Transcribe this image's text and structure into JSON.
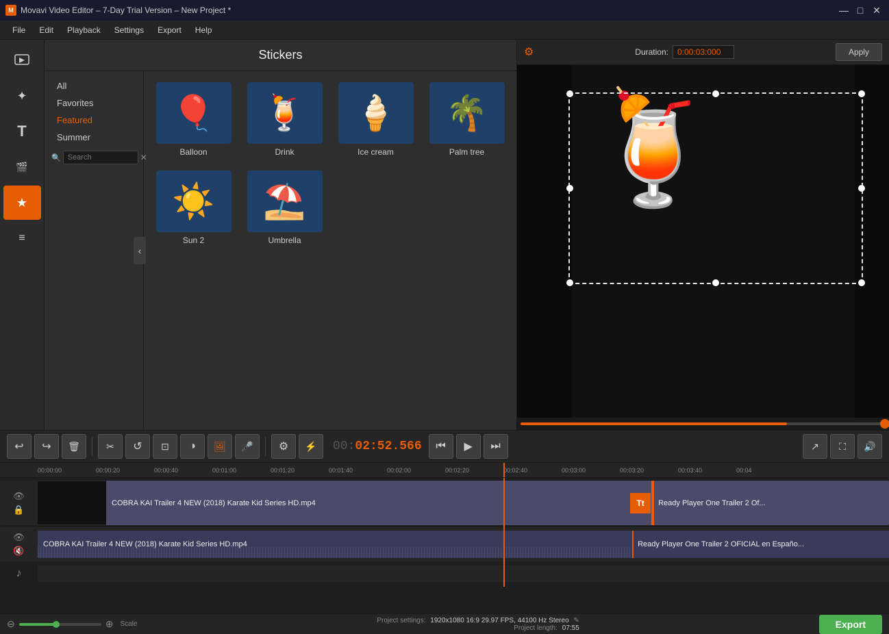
{
  "titlebar": {
    "icon": "M",
    "title": "Movavi Video Editor – 7-Day Trial Version – New Project *",
    "minimize": "—",
    "maximize": "□",
    "close": "✕"
  },
  "menubar": {
    "items": [
      "File",
      "Edit",
      "Playback",
      "Settings",
      "Export",
      "Help"
    ]
  },
  "stickers": {
    "panel_title": "Stickers",
    "categories": [
      "All",
      "Favorites",
      "Featured",
      "Summer"
    ],
    "active_category": "Featured",
    "items": [
      {
        "label": "Balloon",
        "emoji": "🎈"
      },
      {
        "label": "Drink",
        "emoji": "🍹"
      },
      {
        "label": "Ice cream",
        "emoji": "🍦"
      },
      {
        "label": "Palm tree",
        "emoji": "🌴"
      },
      {
        "label": "Sun 2",
        "emoji": "☀️"
      },
      {
        "label": "Umbrella",
        "emoji": "⛱️"
      }
    ],
    "search_placeholder": "Search"
  },
  "preview": {
    "gear_label": "⚙",
    "duration_label": "Duration:",
    "duration_value": "0:00:03:000",
    "apply_label": "Apply"
  },
  "timeline_controls": {
    "undo": "↩",
    "redo": "↪",
    "delete": "🗑",
    "cut": "✂",
    "redo2": "↺",
    "crop": "⊟",
    "color": "◑",
    "image": "🖼",
    "mic": "🎤",
    "settings": "⚙",
    "filter": "⚡",
    "time": "00:02:52.566",
    "skip_back": "⏮",
    "play": "▶",
    "skip_fwd": "⏭",
    "export1": "↗",
    "fullscreen": "⛶",
    "volume": "🔊"
  },
  "timeline": {
    "ruler_marks": [
      "00:00:00",
      "00:00:20",
      "00:00:40",
      "00:01:00",
      "00:01:20",
      "00:01:40",
      "00:02:00",
      "00:02:20",
      "00:02:40",
      "00:03:00",
      "00:03:20",
      "00:03:40",
      "00:04"
    ],
    "track1_name": "COBRA KAI Trailer 4 NEW (2018) Karate Kid Series HD.mp4",
    "track1_name2": "Ready Player One  Trailer 2 Of...",
    "track2_name": "COBRA KAI Trailer 4 NEW (2018) Karate Kid Series HD.mp4",
    "track2_name2": "Ready Player One  Trailer 2 OFICIAL en Españo..."
  },
  "bottom": {
    "project_settings_label": "Project settings:",
    "project_settings_value": "1920x1080 16:9 29.97 FPS, 44100 Hz Stereo",
    "edit_icon": "✎",
    "project_length_label": "Project length:",
    "project_length_value": "07:55",
    "export_label": "Export"
  }
}
